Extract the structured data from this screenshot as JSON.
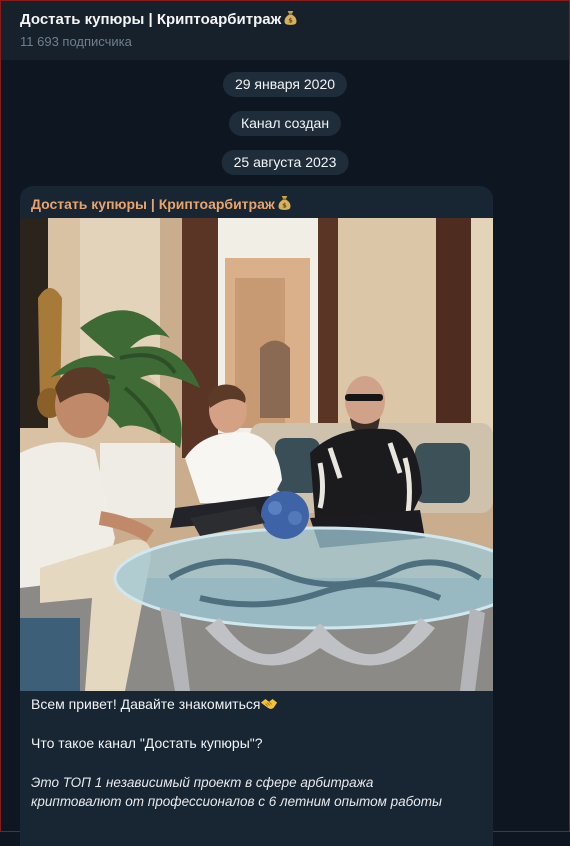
{
  "header": {
    "title": "Достать купюры | Криптоарбитраж",
    "subscribers": "11 693 подписчика"
  },
  "chat": {
    "date_pills": [
      "29 января 2020",
      "25 августа 2023"
    ],
    "service_message": "Канал создан",
    "post": {
      "author": "Достать купюры | Криптоарбитраж",
      "photo_icon": "photo-of-four-men-at-glass-table",
      "text": {
        "greeting": "Всем привет! Давайте знакомиться",
        "question": "Что такое канал \"Достать купюры\"?",
        "italic_line1": "Это ТОП 1 независимый проект в сфере арбитража",
        "italic_line2": "криптовалют от профессионалов с 6 летним опытом работы"
      }
    }
  },
  "colors": {
    "background": "#0e1621",
    "header": "#17212b",
    "bubble": "#182533",
    "author": "#e8a46a",
    "pill": "#1f2c3a"
  }
}
